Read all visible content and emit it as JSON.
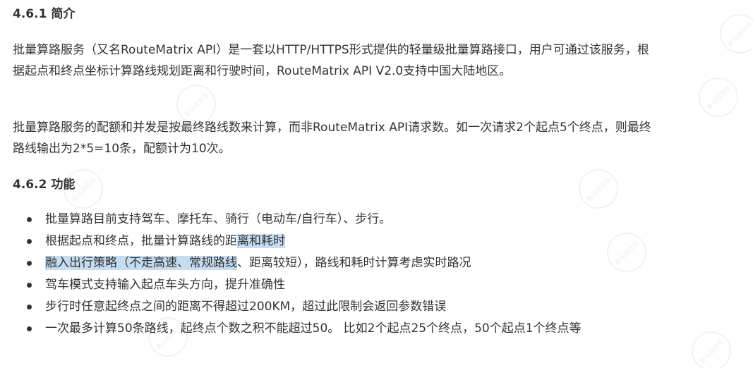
{
  "sections": [
    {
      "heading": "4.6.1 简介",
      "paragraphs": [
        "批量算路服务（又名RouteMatrix API）是一套以HTTP/HTTPS形式提供的轻量级批量算路接口，用户可通过该服务，根据起点和终点坐标计算路线规划距离和行驶时间，RouteMatrix API V2.0支持中国大陆地区。",
        "批量算路服务的配额和并发是按最终路线数来计算，而非RouteMatrix API请求数。如一次请求2个起点5个终点，则最终路线输出为2*5=10条，配额计为10次。"
      ]
    },
    {
      "heading": "4.6.2 功能",
      "items": [
        {
          "text": "批量算路目前支持驾车、摩托车、骑行（电动车/自行车）、步行。"
        },
        {
          "pre": "根据起点和终点，批量计算路线的距",
          "highlight": "离和耗时",
          "post": ""
        },
        {
          "pre": "",
          "highlight": "融入出行策略（不走高速、常规路线",
          "post": "、距离较短），路线和耗时计算考虑实时路况"
        },
        {
          "text": "驾车模式支持输入起点车头方向，提升准确性"
        },
        {
          "text": "步行时任意起终点之间的距离不得超过200KM，超过此限制会返回参数错误"
        },
        {
          "text": "一次最多计算50条路线，起终点个数之积不能超过50。 比如2个起点25个终点，50个起点1个终点等"
        }
      ]
    }
  ],
  "watermark_text": "黑马程序员"
}
